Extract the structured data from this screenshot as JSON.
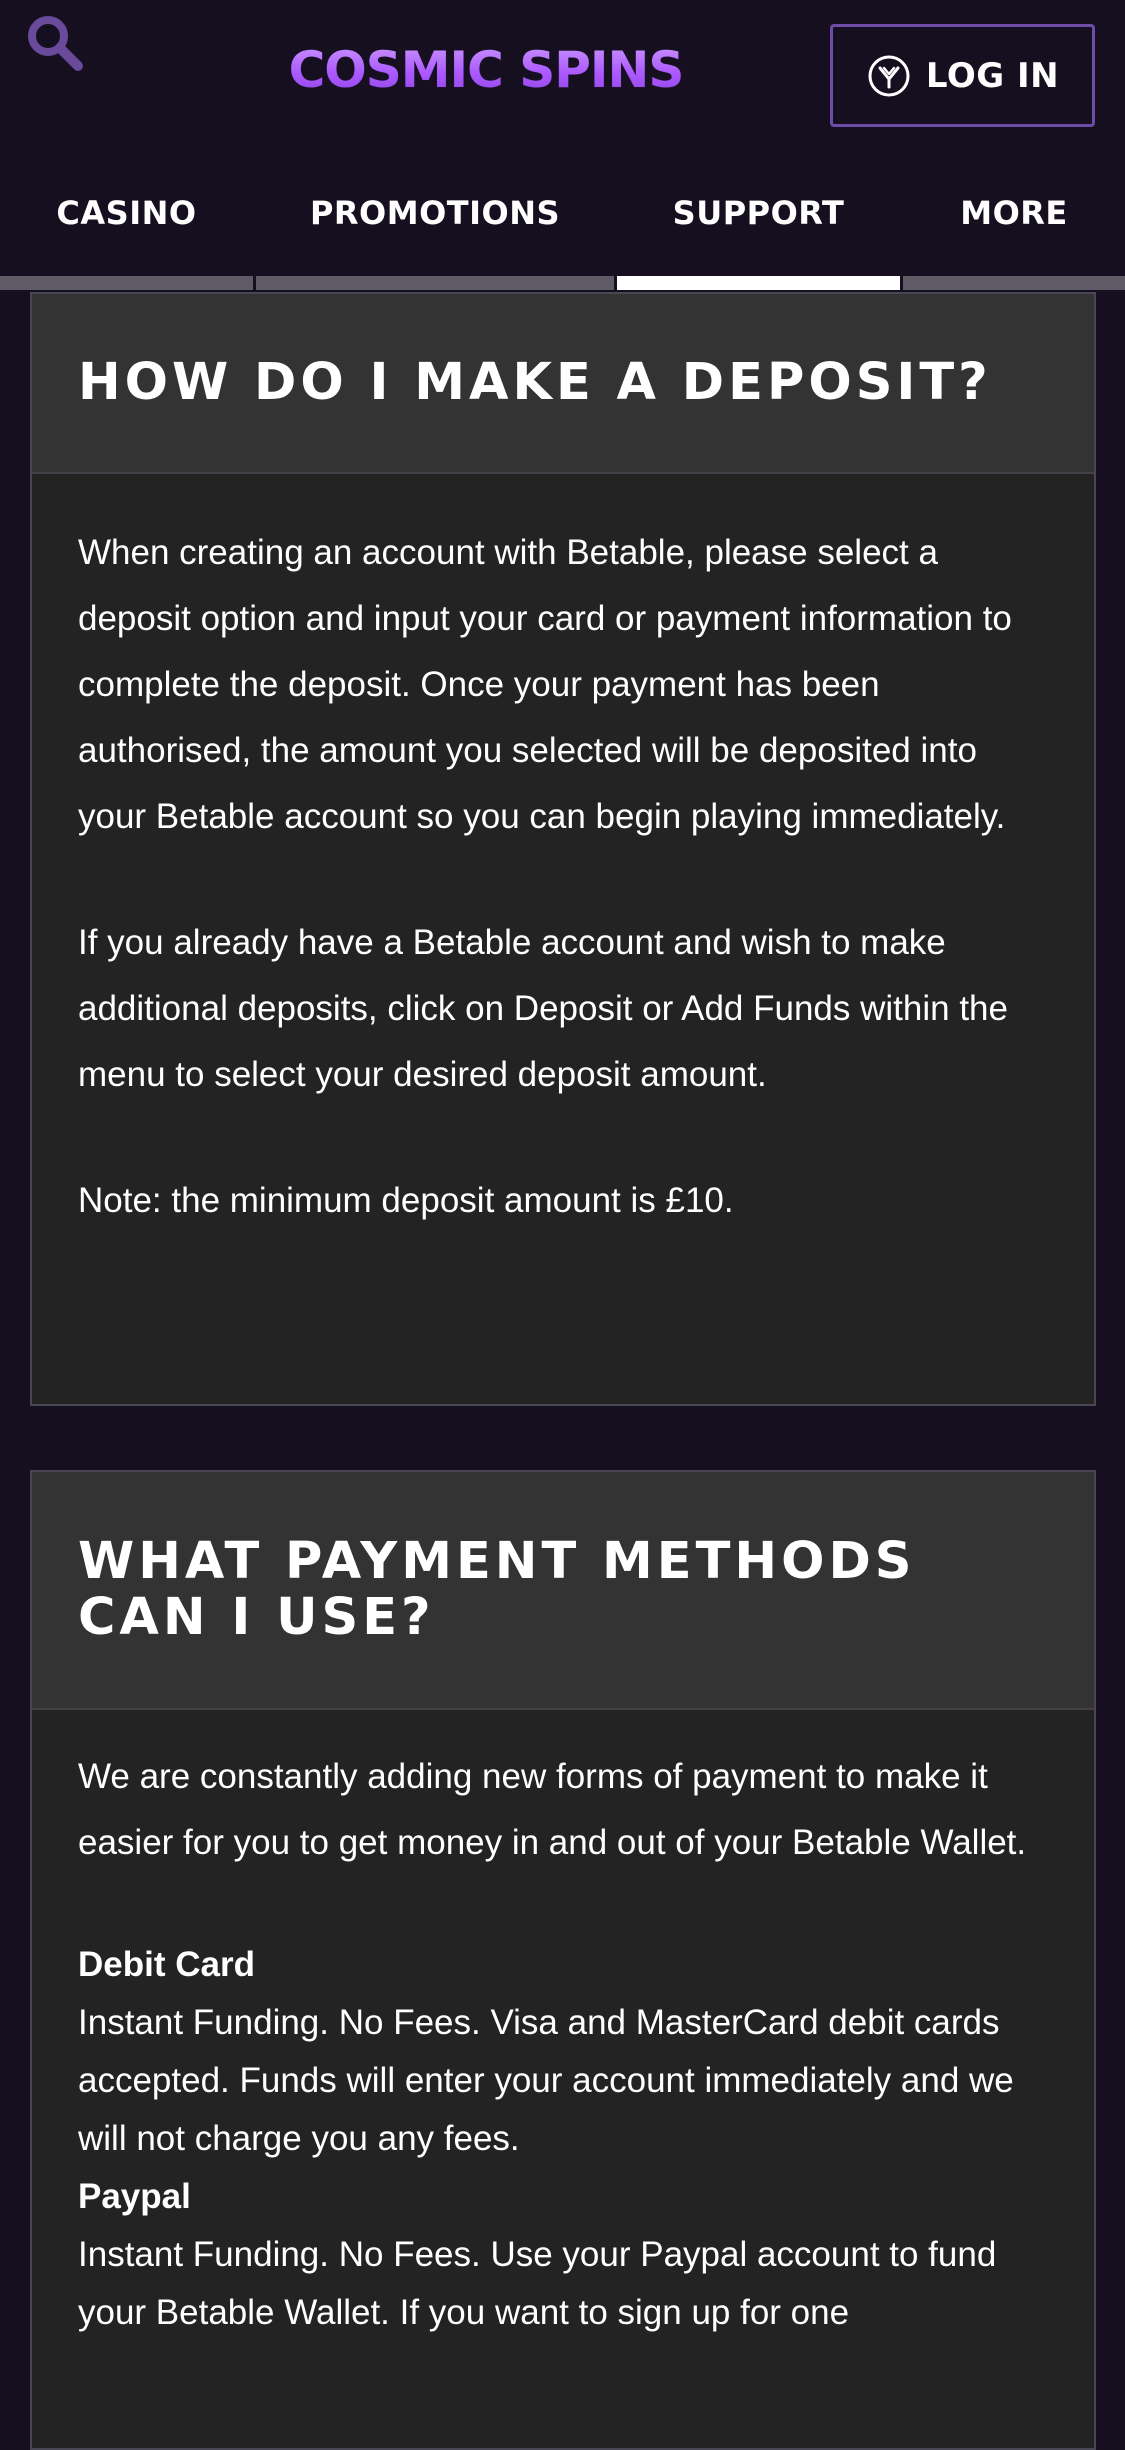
{
  "header": {
    "logo_text": "COSMIC SPINS",
    "login_label": "LOG IN"
  },
  "nav": {
    "tabs": [
      {
        "label": "CASINO",
        "active": false
      },
      {
        "label": "PROMOTIONS",
        "active": false
      },
      {
        "label": "SUPPORT",
        "active": true
      },
      {
        "label": "MORE",
        "active": false
      }
    ]
  },
  "faq": [
    {
      "title": "HOW DO I MAKE A DEPOSIT?",
      "paragraphs": [
        "When creating an account with Betable, please select a deposit option and input your card or payment information to complete the deposit. Once your payment has been authorised, the amount you selected will be deposited into your Betable account so you can begin playing immediately.",
        "If you already have a Betable account and wish to make additional deposits, click on Deposit or Add Funds within the menu to select your desired deposit amount.",
        "Note: the minimum deposit amount is £10."
      ]
    },
    {
      "title": "WHAT PAYMENT METHODS CAN I USE?",
      "intro": "We are constantly adding new forms of payment to make it easier for you to get money in and out of your Betable Wallet.",
      "methods": [
        {
          "name": "Debit Card",
          "text": "Instant Funding. No Fees. Visa and MasterCard debit cards accepted. Funds will enter your account immediately and we will not charge you any fees."
        },
        {
          "name": "Paypal",
          "text": "Instant Funding. No Fees. Use your Paypal account to fund your Betable Wallet. If you want to sign up for one"
        }
      ]
    }
  ],
  "colors": {
    "page_bg": "#150f20",
    "card_bg": "#232323",
    "card_header_bg": "#333333",
    "accent_purple": "#a54dff",
    "login_border": "#6d4ca8",
    "active_tab_bar": "#ffffff",
    "inactive_tab_bar": "#5e5a66"
  },
  "icons": {
    "search": "search-icon",
    "login": "betable-logo-icon"
  }
}
